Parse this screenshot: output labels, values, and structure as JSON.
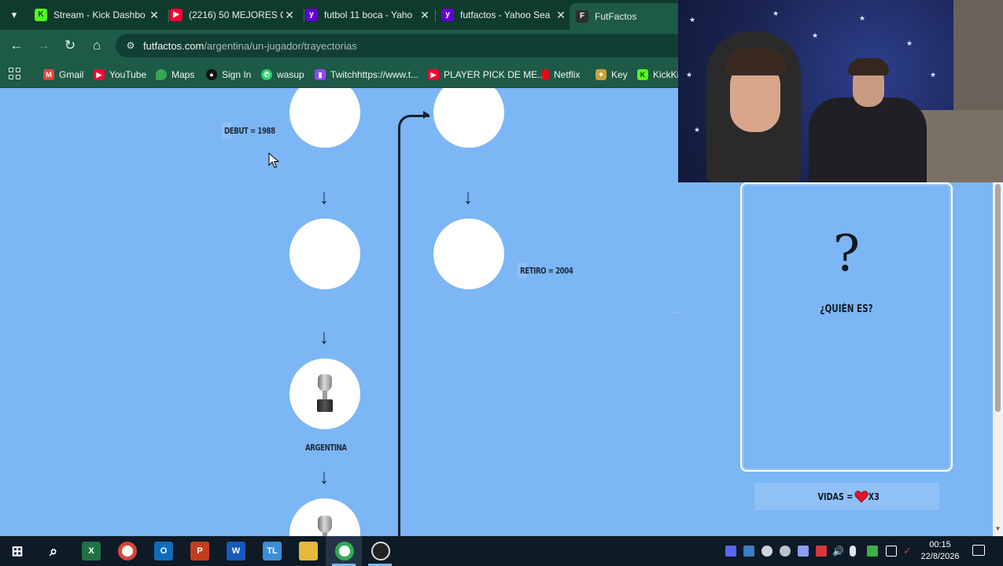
{
  "tabs": [
    {
      "title": "Stream - Kick Dashbo",
      "favicon": "kick-icon",
      "color": "#53fc18",
      "active": false
    },
    {
      "title": "(2216) 50 MEJORES C",
      "favicon": "youtube-icon",
      "color": "#ff0033",
      "active": false
    },
    {
      "title": "futbol 11 boca - Yaho",
      "favicon": "yahoo-icon",
      "color": "#6001d2",
      "active": false
    },
    {
      "title": "futfactos - Yahoo Sea",
      "favicon": "yahoo-icon",
      "color": "#6001d2",
      "active": false
    },
    {
      "title": "FutFactos",
      "favicon": "futfactos-icon",
      "color": "#2f2f2f",
      "active": true
    }
  ],
  "address_bar": {
    "host": "futfactos.com",
    "path": "/argentina/un-jugador/trayectorias"
  },
  "bookmarks": [
    {
      "label": "Gmail",
      "icon": "gmail-icon",
      "color": "#ea4335"
    },
    {
      "label": "YouTube",
      "icon": "youtube-icon",
      "color": "#ff0033"
    },
    {
      "label": "Maps",
      "icon": "maps-icon",
      "color": "#34a853"
    },
    {
      "label": "Sign In",
      "icon": "signin-icon",
      "color": "#111111"
    },
    {
      "label": "wasup",
      "icon": "whatsapp-icon",
      "color": "#25d366"
    },
    {
      "label": "Twitchhttps://www.t...",
      "icon": "twitch-icon",
      "color": "#9146ff"
    },
    {
      "label": "PLAYER PICK DE ME...",
      "icon": "youtube-icon",
      "color": "#ff0033"
    },
    {
      "label": "Netflix",
      "icon": "netflix-icon",
      "color": "#e50914"
    },
    {
      "label": "Key",
      "icon": "key-icon",
      "color": "#c9a23a"
    },
    {
      "label": "KickKi",
      "icon": "kick-icon",
      "color": "#53fc18"
    }
  ],
  "trajectory": {
    "debut_label": "DEBUT = 1988",
    "retiro_label": "RETIRO = 2004",
    "argentina_label": "ARGENTINA",
    "arrow_glyph": "↓"
  },
  "card": {
    "mystery": "?",
    "question": "¿QUIÉN ES?"
  },
  "lives": {
    "prefix": "VIDAS =",
    "count": "X3",
    "value": 3
  },
  "taskbar": {
    "time": "00:15",
    "date": "22/8/2026"
  },
  "colors": {
    "page_bg": "#7cb6f4",
    "chrome_dark": "#0f3b2e",
    "chrome_light": "#1d5a48",
    "heart": "#e0162b"
  }
}
